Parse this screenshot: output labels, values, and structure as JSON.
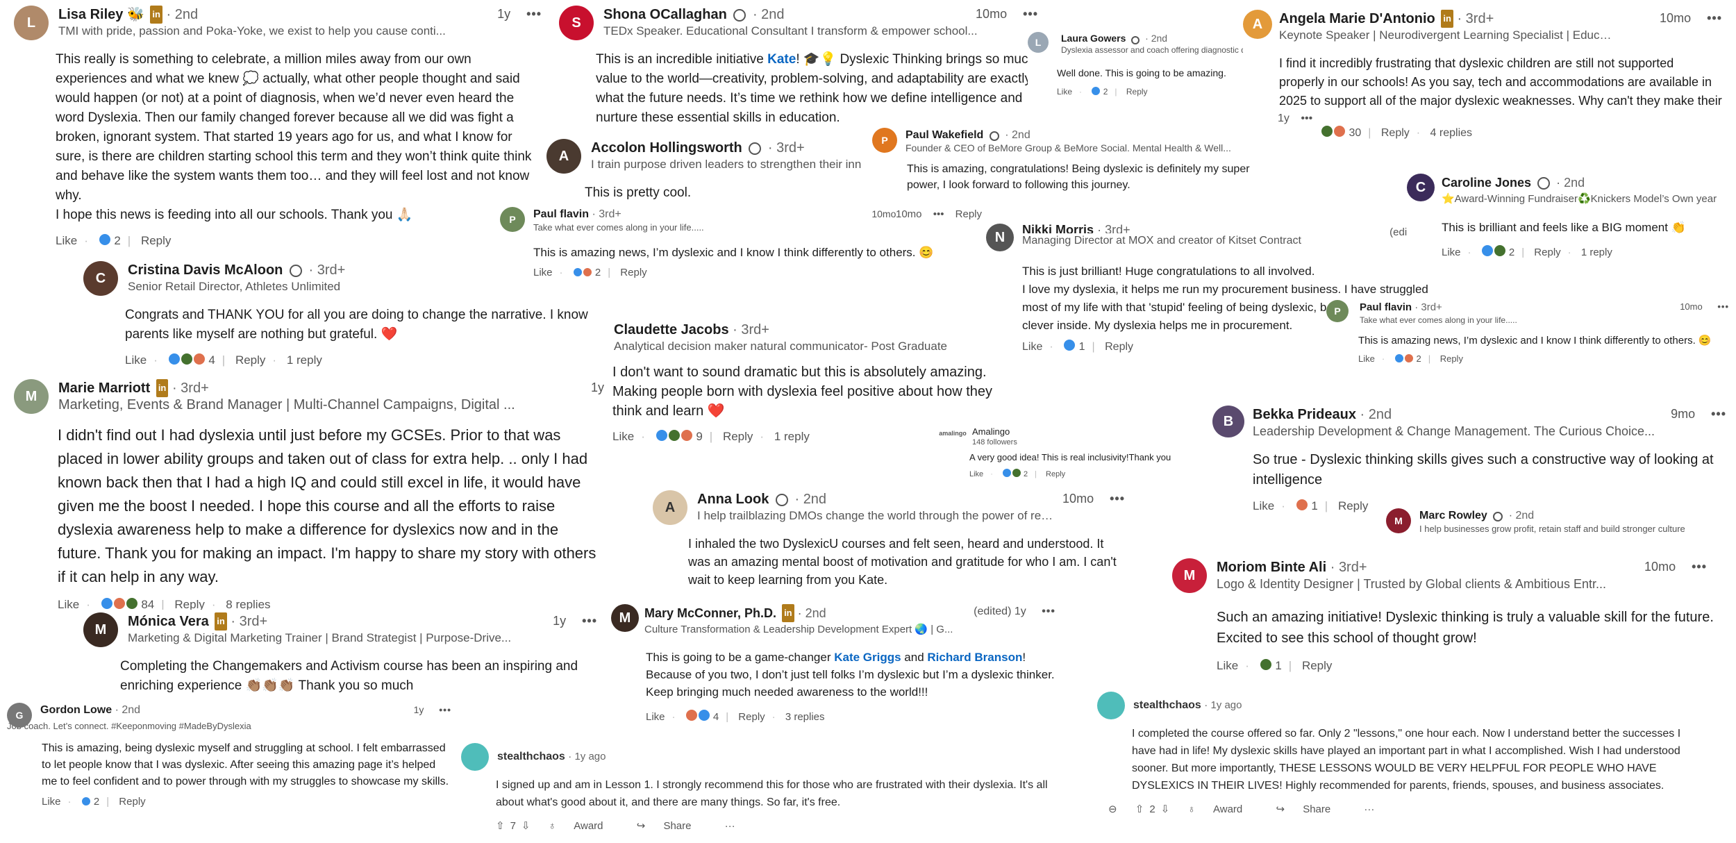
{
  "comments": {
    "lisa": {
      "name": "Lisa Riley",
      "emoji": "🐝",
      "degree": "2nd",
      "title": "TMI with pride, passion and Poka-Yoke, we exist to help you cause conti...",
      "time": "1y",
      "body": "This really is something to celebrate, a million miles away from our own experiences and what we knew 💭 actually, what other people thought and said would happen (or not) at a point of diagnosis, when we’d never even heard the word Dyslexia. Then our family changed forever because all we did was fight a broken, ignorant system. That started 19 years ago for us, and what I know for sure, is there are children starting school this term and they won’t think quite think and behave like the system wants them too… and they will feel lost and not know why.\nI hope this news is feeding into all our schools. Thank you 🙏🏻",
      "like": "Like",
      "count": "2",
      "reply": "Reply"
    },
    "cristina": {
      "name": "Cristina Davis McAloon",
      "degree": "3rd+",
      "title": "Senior Retail Director, Athletes Unlimited",
      "body": "Congrats and THANK YOU for all you are doing to change the narrative. I know parents like myself are nothing but grateful. ❤️",
      "like": "Like",
      "count": "4",
      "reply": "Reply",
      "replies": "1 reply"
    },
    "marie": {
      "name": "Marie Marriott",
      "degree": "3rd+",
      "title": "Marketing, Events & Brand Manager | Multi-Channel Campaigns, Digital ...",
      "time": "1y",
      "body": "I didn't find out I had dyslexia until just before my GCSEs. Prior to that was placed in lower ability groups and taken out of class for extra help. .. only I had known back then that I had a high IQ and could still excel in life, it would have given me the boost I needed. I hope this course and all the efforts to raise dyslexia awareness help to make a difference for dyslexics now and in the future. Thank you for making an impact. I'm happy to share my story with others if it can help in any way.",
      "like": "Like",
      "count": "84",
      "reply": "Reply",
      "replies": "8 replies"
    },
    "monica": {
      "name": "Mónica Vera",
      "degree": "3rd+",
      "title": "Marketing & Digital Marketing Trainer | Brand Strategist | Purpose-Drive...",
      "time": "1y",
      "body": "Completing the Changemakers and Activism course has been an inspiring and enriching experience 👏🏽👏🏽👏🏽 Thank you so much"
    },
    "gordon": {
      "name": "Gordon Lowe",
      "degree": "2nd",
      "title": "Job coach. Let’s connect. #Keeponmoving #MadeByDyslexia",
      "time": "1y",
      "body": "This is amazing, being dyslexic myself and struggling at school. I felt embarrassed to let people know that I was dyslexic. After seeing this amazing page it’s helped me to feel confident and to power through with my struggles to showcase my skills.",
      "like": "Like",
      "count": "2",
      "reply": "Reply"
    },
    "shona": {
      "name": "Shona OCallaghan",
      "degree": "2nd",
      "title": "TEDx Speaker. Educational Consultant I transform & empower school...",
      "time": "10mo",
      "body_pre": "This is an incredible initiative ",
      "body_link": "Kate",
      "body_post": "! 🎓💡 Dyslexic Thinking brings so much value to the world—creativity, problem-solving, and adaptability are exactly what the future needs. It’s time we rethink how we define intelligence and nurture these essential skills in education."
    },
    "accolon": {
      "name": "Accolon Hollingsworth",
      "degree": "3rd+",
      "title": "I train purpose driven leaders to strengthen their inn",
      "body": "This is pretty cool."
    },
    "paulf1": {
      "name": "Paul flavin",
      "degree": "3rd+",
      "title": "Take what ever comes along in your life.....",
      "time": "10mo",
      "body": "This is amazing news, I’m dyslexic and I know I think differently to others. 😊",
      "like": "Like",
      "count": "2",
      "reply": "Reply"
    },
    "claudette": {
      "name": "Claudette Jacobs",
      "degree": "3rd+",
      "title": "Analytical decision maker natural communicator- Post Graduate",
      "body": "I don't want to sound dramatic but this is absolutely amazing. Making people born with dyslexia feel positive about how they think and learn ❤️",
      "like": "Like",
      "count": "9",
      "reply": "Reply",
      "replies": "1 reply"
    },
    "anna": {
      "name": "Anna Look",
      "degree": "2nd",
      "title": "I help trailblazing DMOs change the world through the power of rege...",
      "time": "10mo",
      "body": "I inhaled the two DyslexicU courses and felt seen, heard and understood. It was an amazing mental boost of motivation and gratitude for who I am. I can't wait to keep learning from you Kate."
    },
    "mary": {
      "name": "Mary McConner, Ph.D.",
      "degree": "2nd",
      "title": "Culture Transformation & Leadership Development Expert 🌏 | G...",
      "time": "(edited) 1y",
      "body_pre": "This is going to be a game-changer ",
      "link1": "Kate Griggs",
      "mid": " and ",
      "link2": "Richard Branson",
      "body_post": "! Because of you two, I don’t just tell folks I’m dyslexic but I’m a dyslexic thinker. Keep bringing much needed awareness to the world!!!",
      "like": "Like",
      "count": "4",
      "reply": "Reply",
      "replies": "3 replies"
    },
    "laura": {
      "name": "Laura Gowers",
      "degree": "2nd",
      "title": "Dyslexia assessor and coach offering diagnostic dy",
      "body": "Well done. This is going to be amazing.",
      "like": "Like",
      "count": "2",
      "reply": "Reply"
    },
    "paulw": {
      "name": "Paul Wakefield",
      "degree": "2nd",
      "title": "Founder & CEO of BeMore Group & BeMore Social. Mental Health & Well...",
      "body": "This is amazing, congratulations! Being dyslexic is definitely my super power, I look forward to following this journey.",
      "time": "10mo",
      "reply": "Reply"
    },
    "nikki": {
      "name": "Nikki Morris",
      "degree": "3rd+",
      "title": "Managing Director at MOX and creator of Kitset Contract",
      "time": "(edited)",
      "body": "This is just brilliant! Huge congratulations to all involved.\nI love my dyslexia, it helps me run my procurement business. I have struggled most of my life with that 'stupid' feeling of being dyslexic, but I always felt clever inside. My dyslexia helps me in procurement.",
      "like": "Like",
      "count": "1",
      "reply": "Reply"
    },
    "amalingo": {
      "name": "Amalingo",
      "followers": "148 followers",
      "body": "A very good idea! This is real inclusivity!Thank you",
      "like": "Like",
      "count": "2",
      "reply": "Reply"
    },
    "angela": {
      "name": "Angela Marie D'Antonio",
      "degree": "3rd+",
      "title": "Keynote Speaker | Neurodivergent Learning Specialist | Education Sal...",
      "time": "10mo",
      "body": "I find it incredibly frustrating that dyslexic children are still not supported properly in our schools! As you say, tech and accommodations are available in 2025 to support all of the major dyslexic weaknesses. Why can't they make their way into the schools?!",
      "age": "1y",
      "count": "30",
      "reply": "Reply",
      "replies": "4 replies"
    },
    "caroline": {
      "name": "Caroline Jones",
      "degree": "2nd",
      "title": "⭐Award-Winning Fundraiser♻️Knickers Model’s Own year",
      "body": "This is brilliant and feels like a BIG moment 👏",
      "like": "Like",
      "count": "2",
      "reply": "Reply",
      "replies": "1 reply"
    },
    "paulf2": {
      "name": "Paul flavin",
      "degree": "3rd+",
      "title": "Take what ever comes along in your life.....",
      "time": "10mo",
      "body": "This is amazing news, I’m dyslexic and I know I think differently to others. 😊",
      "like": "Like",
      "count": "2",
      "reply": "Reply"
    },
    "bekka": {
      "name": "Bekka Prideaux",
      "degree": "2nd",
      "title": "Leadership Development & Change Management. The Curious Choice...",
      "time": "9mo",
      "body": "So true - Dyslexic thinking skills gives such a constructive way of looking at intelligence",
      "like": "Like",
      "count": "1",
      "reply": "Reply"
    },
    "marc": {
      "name": "Marc Rowley",
      "degree": "2nd",
      "title": "I help businesses grow profit, retain staff and build stronger culture"
    },
    "moriom": {
      "name": "Moriom Binte Ali",
      "degree": "3rd+",
      "title": "Logo & Identity Designer | Trusted by Global clients & Ambitious Entr...",
      "time": "10mo",
      "body": "Such an amazing initiative! Dyslexic thinking is truly a valuable skill for the future. Excited to see this school of thought grow!",
      "like": "Like",
      "count": "1",
      "reply": "Reply"
    },
    "stealth1": {
      "name": "stealthchaos",
      "age": "1y ago",
      "body": "I signed up and am in Lesson 1. I strongly recommend this for those who are frustrated with their dyslexia. It's all about what's good about it, and there are many things. So far, it's free.",
      "votes": "7",
      "award": "Award",
      "share": "Share"
    },
    "stealth2": {
      "name": "stealthchaos",
      "age": "1y ago",
      "body": "I completed the course offered so far. Only 2 \"lessons,\" one hour each. Now I understand better the successes I have had in life! My dyslexic skills have played an important part in what I accomplished. Wish I had understood sooner. But more importantly, THESE LESSONS WOULD BE VERY HELPFUL FOR PEOPLE WHO HAVE DYSLEXICS IN THEIR LIVES! Highly recommended for parents, friends, spouses, and business associates.",
      "votes": "2",
      "award": "Award",
      "share": "Share"
    }
  },
  "colors": {
    "link": "#0a66c2",
    "reddit_avatar": "#4fbdba",
    "premium": "#b07b1b"
  },
  "glyphs": {
    "dots": "•••",
    "ellipsis": "···",
    "up": "⇧",
    "down": "⇩",
    "award": "♁",
    "share": "↪",
    "collapse": "⊖"
  }
}
